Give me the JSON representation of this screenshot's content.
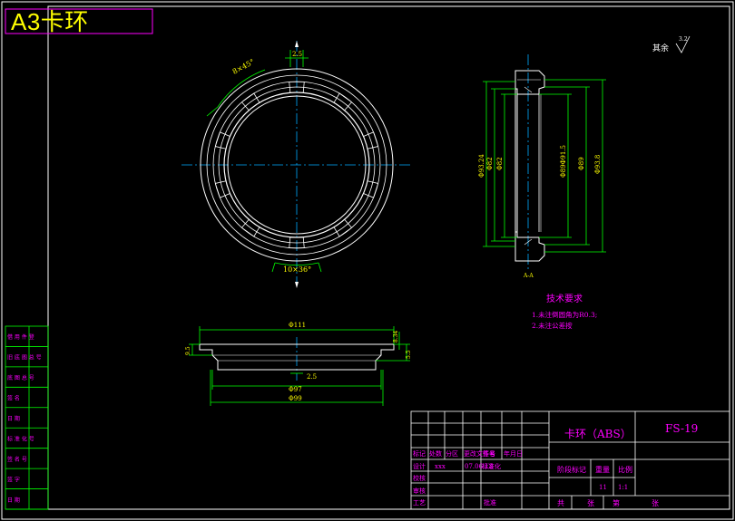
{
  "sheet": {
    "corner_label": "A3卡环",
    "roughness_label": "其余",
    "roughness_value": "3.2"
  },
  "colors": {
    "background": "#000000",
    "frame": "#ffffff",
    "outline": "#ffffff",
    "dimension": "#00ff00",
    "centerline": "#00aaff",
    "annotation": "#ff00ff",
    "label": "#ffff00",
    "title_block": "#00ff00",
    "table_text": "#ff00ff"
  },
  "front_view": {
    "angle_top": "8×45°",
    "angle_bottom": "10×36°",
    "top_dim": "2.5"
  },
  "section_view": {
    "dims": [
      "Φ93.24",
      "Φ82",
      "Φ82",
      "Φ89Φ91.5",
      "Φ89",
      "Φ93.8"
    ],
    "section_label": "A-A"
  },
  "side_view": {
    "top_dim": "Φ111",
    "right_dim": "8.34",
    "left_dim": "9.5",
    "mid_dim": "2.5",
    "inner_dim": "Φ97",
    "bottom_dim": "Φ99",
    "small_dim": "5.5"
  },
  "tech_requirements": {
    "title": "技术要求",
    "items": [
      "1.未注倒圆角为R0.3;",
      "2.未注公差按"
    ]
  },
  "left_table": {
    "rows": [
      "借 用 件 登",
      "旧 底 图 总 号",
      "底 图 总 号",
      "签 名",
      "日 期",
      "标 准 化 号",
      "签 名 号",
      "签  字",
      "日  期"
    ]
  },
  "title_block": {
    "part_name": "卡环（ABS）",
    "drawing_no": "FS-19",
    "header_row": [
      "标记",
      "处数",
      "分区",
      "更改文件号",
      "签名",
      "年月日"
    ],
    "design_label": "设计",
    "designer": "xxx",
    "date": "07.06.12",
    "std_label": "标准化",
    "check_label": "校核",
    "review_label": "审核",
    "process_label": "工艺",
    "approve_label": "批准",
    "stage_label": "阶段标记",
    "weight_label": "重量",
    "scale_label": "比例",
    "weight_value": "11",
    "scale_value": "1:1",
    "total_label": "共",
    "sheet_label": "张",
    "page_label": "第",
    "page_suffix": "张"
  }
}
